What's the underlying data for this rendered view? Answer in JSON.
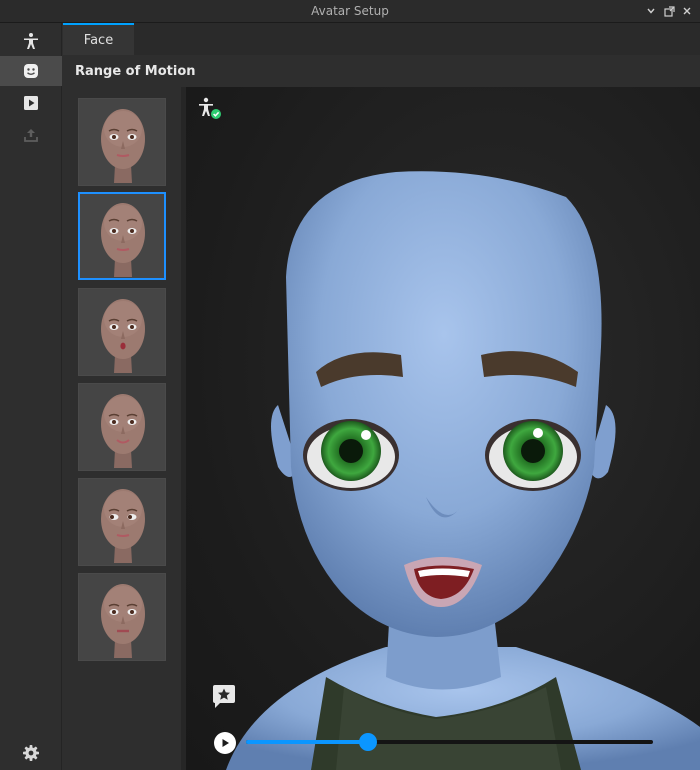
{
  "window": {
    "title": "Avatar Setup"
  },
  "window_controls": [
    {
      "icon": "chevron-down-icon"
    },
    {
      "icon": "restore-icon"
    },
    {
      "icon": "close-icon"
    }
  ],
  "left_toolbar": [
    {
      "icon": "body-icon"
    },
    {
      "icon": "face-icon",
      "active": true
    },
    {
      "icon": "play-animation-icon"
    },
    {
      "icon": "upload-icon",
      "disabled": true
    }
  ],
  "settings_icon": "gear-icon",
  "tabs": [
    {
      "label": "Face",
      "active": true
    }
  ],
  "section": {
    "title": "Range of Motion"
  },
  "thumbnails": [
    {
      "expression": "neutral"
    },
    {
      "expression": "raised-brows",
      "selected": true
    },
    {
      "expression": "pucker"
    },
    {
      "expression": "smile"
    },
    {
      "expression": "eyes-left"
    },
    {
      "expression": "lip-press"
    }
  ],
  "viewport": {
    "status_icon": "avatar-check-icon",
    "comment_icon": "star-comment-icon",
    "playback": {
      "progress": 0.3
    }
  },
  "colors": {
    "accent": "#00a2ff",
    "slider": "#0b96ff",
    "skin": "#8fb0dc",
    "eyes": "#2e8a2e",
    "status_ok": "#2ecc71"
  }
}
